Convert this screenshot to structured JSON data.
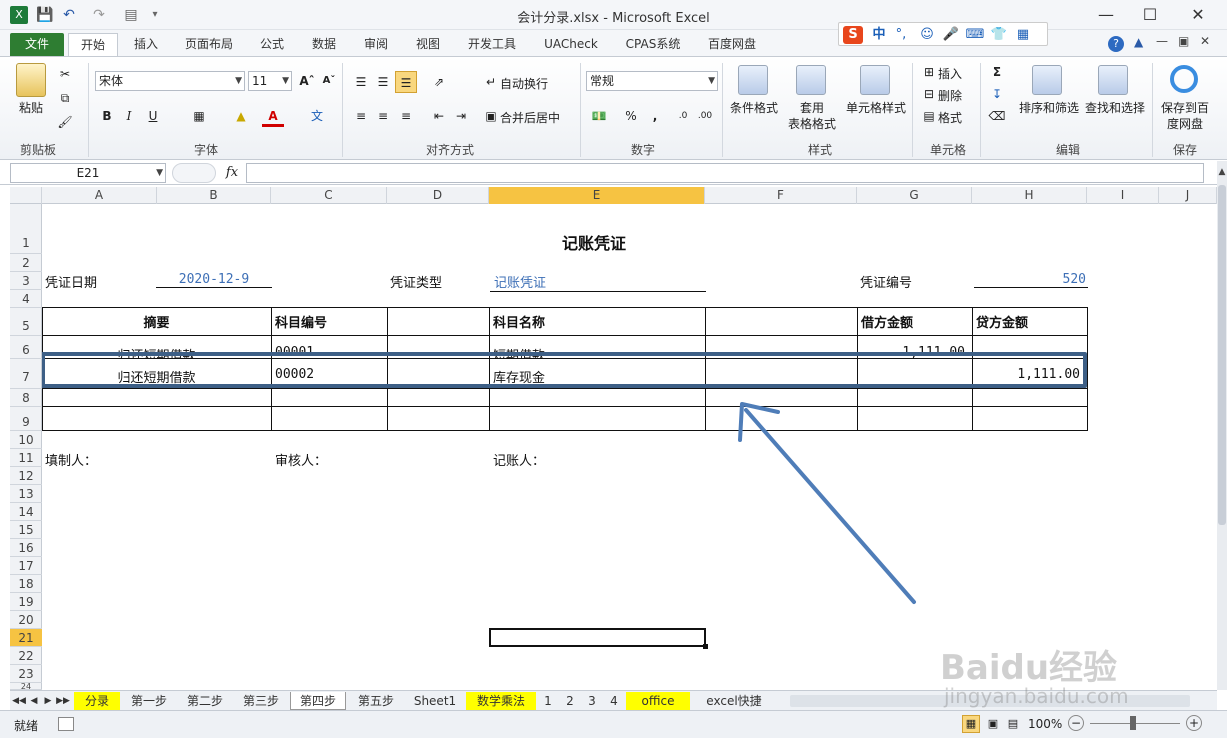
{
  "window": {
    "title": "会计分录.xlsx - Microsoft Excel"
  },
  "ribbon_tabs": [
    "文件",
    "开始",
    "插入",
    "页面布局",
    "公式",
    "数据",
    "审阅",
    "视图",
    "开发工具",
    "UACheck",
    "CPAS系统",
    "百度网盘"
  ],
  "ime": {
    "label": "中"
  },
  "ribbon": {
    "clipboard": {
      "paste": "粘贴",
      "group": "剪贴板"
    },
    "font": {
      "name": "宋体",
      "size": "11",
      "group": "字体",
      "bold": "B",
      "italic": "I",
      "underline": "U"
    },
    "align": {
      "wrap": "自动换行",
      "merge": "合并后居中",
      "group": "对齐方式"
    },
    "number": {
      "format": "常规",
      "group": "数字",
      "percent": "%",
      "comma": ","
    },
    "styles": {
      "cond": "条件格式",
      "table_1": "套用",
      "table_2": "表格格式",
      "cell_style": "单元格样式",
      "group": "样式"
    },
    "cells": {
      "insert": "插入",
      "delete": "删除",
      "format": "格式",
      "group": "单元格"
    },
    "editing": {
      "sort": "排序和筛选",
      "find": "查找和选择",
      "group": "编辑"
    },
    "save": {
      "label_1": "保存到百",
      "label_2": "度网盘",
      "group": "保存"
    }
  },
  "formula_bar": {
    "name_box": "E21",
    "fx": "fx",
    "value": ""
  },
  "columns": [
    "A",
    "B",
    "C",
    "D",
    "E",
    "F",
    "G",
    "H",
    "I",
    "J"
  ],
  "rows": [
    "1",
    "2",
    "3",
    "4",
    "5",
    "6",
    "7",
    "8",
    "9",
    "10",
    "11",
    "12",
    "13",
    "14",
    "15",
    "16",
    "17",
    "18",
    "19",
    "20",
    "21",
    "22",
    "23",
    "24"
  ],
  "voucher": {
    "title": "记账凭证",
    "date_label": "凭证日期",
    "date_value": "2020-12-9",
    "type_label": "凭证类型",
    "type_value": "记账凭证",
    "no_label": "凭证编号",
    "no_value": "520",
    "headers": {
      "summary": "摘要",
      "code": "科目编号",
      "name": "科目名称",
      "debit": "借方金额",
      "credit": "贷方金额"
    },
    "entries": [
      {
        "summary": "归还短期借款",
        "code": "00001",
        "name": "短期借款",
        "debit": "1,111.00",
        "credit": ""
      },
      {
        "summary": "归还短期借款",
        "code": "00002",
        "name": "库存现金",
        "debit": "",
        "credit": "1,111.00"
      }
    ],
    "preparer": "填制人：",
    "reviewer": "审核人：",
    "bookkeeper": "记账人："
  },
  "sheet_tabs": [
    "分录",
    "第一步",
    "第二步",
    "第三步",
    "第四步",
    "第五步",
    "Sheet1",
    "数学乘法",
    "1",
    "2",
    "3",
    "4",
    "office",
    "excel快捷"
  ],
  "status": {
    "ready": "就绪",
    "zoom": "100%"
  },
  "watermark": {
    "brand": "Baidu经验",
    "url": "jingyan.baidu.com"
  },
  "colors": {
    "accent_blue": "#3d6fb6",
    "file_tab": "#2e7d32",
    "highlight_tab": "#ffff00",
    "selected_row_header": "#f6c342"
  }
}
